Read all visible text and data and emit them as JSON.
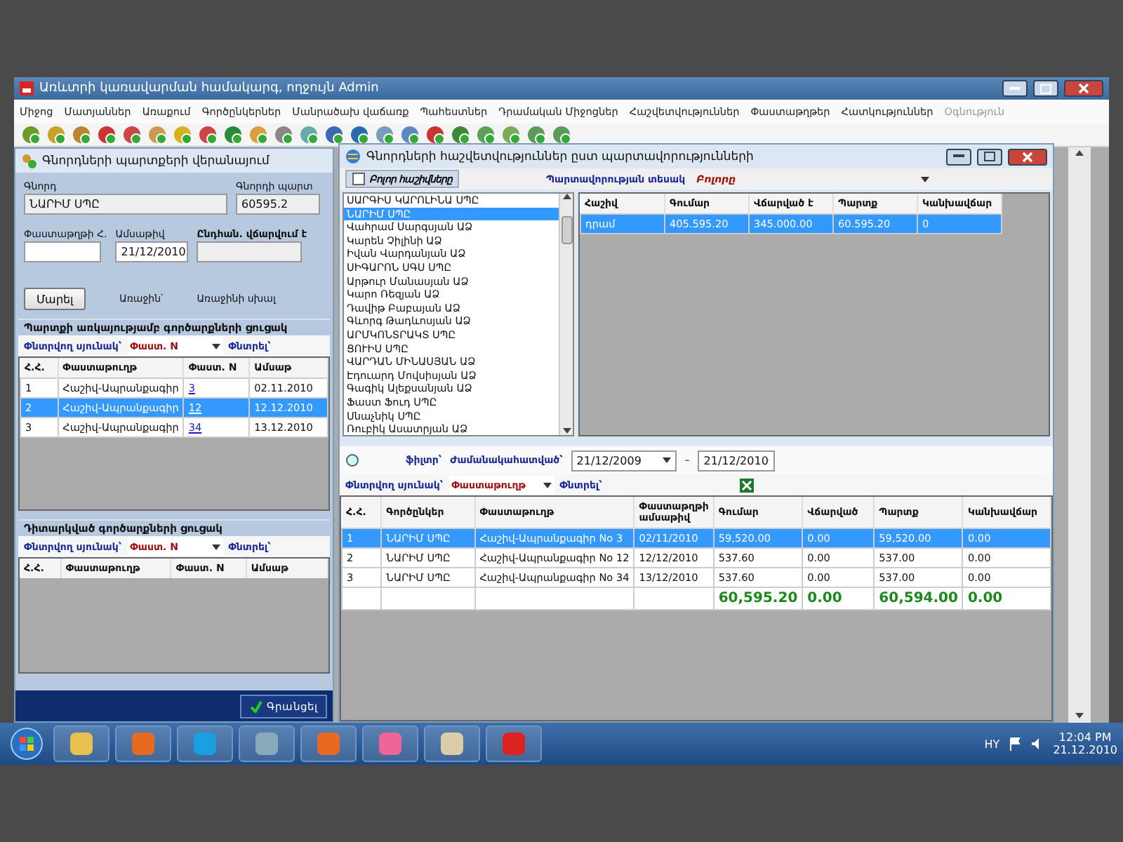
{
  "window": {
    "title": "Առևտրի կառավարման համակարգ, ողջույն Admin"
  },
  "menu": [
    {
      "label": "Միջոց",
      "disabled": false
    },
    {
      "label": "Մատյաններ",
      "disabled": false
    },
    {
      "label": "Առաքում",
      "disabled": false
    },
    {
      "label": "Գործընկերներ",
      "disabled": false
    },
    {
      "label": "Մանրածախ վաճառք",
      "disabled": false
    },
    {
      "label": "Պահեստներ",
      "disabled": false
    },
    {
      "label": "Դրամական Միջոցներ",
      "disabled": false
    },
    {
      "label": "Հաշվետվություններ",
      "disabled": false
    },
    {
      "label": "Փաստաթղթեր",
      "disabled": false
    },
    {
      "label": "Հատկություններ",
      "disabled": false
    },
    {
      "label": "Օգնություն",
      "disabled": true
    }
  ],
  "left_panel": {
    "title": "Գնորդների պարտքերի վերանայում",
    "buyer_label": "Գնորդ",
    "buyer_value": "ՆԱՐԻՄ ՍՊԸ",
    "debt_label": "Գնորդի պարտ",
    "debt_value": "60595.2",
    "doc_label": "Փաստաթղթի Հ.",
    "date_label": "Ամսաթիվ",
    "date_value": "21/12/2010",
    "total_label": "Ընդհան. վճարվում է",
    "pay_button": "Մարել",
    "first_label": "Առաջին՝",
    "first_value": "Առաջինի սխալ",
    "debts": {
      "title": "Պարտքի առկայությամբ գործարքների ցուցակ",
      "search_label": "Փնտրվող սյունակ՝",
      "search_column": "Փաստ. N",
      "find_label": "Փնտրել՝",
      "columns": [
        "Հ.Հ.",
        "Փաստաթուղթ",
        "Փաստ. N",
        "Ամսաթ"
      ],
      "rows": [
        {
          "cells": [
            "1",
            "Հաշիվ-Ապրանքագիր",
            "3",
            "02.11.2010"
          ],
          "selected": false
        },
        {
          "cells": [
            "2",
            "Հաշիվ-Ապրանքագիր",
            "12",
            "12.12.2010"
          ],
          "selected": true
        },
        {
          "cells": [
            "3",
            "Հաշիվ-Ապրանքագիր",
            "34",
            "13.12.2010"
          ],
          "selected": false
        }
      ]
    },
    "reviewed": {
      "title": "Դիտարկված գործարքների ցուցակ",
      "search_label": "Փնտրվող սյունակ՝",
      "search_column": "Փաստ. N",
      "find_label": "Փնտրել՝",
      "columns": [
        "Հ.Հ.",
        "Փաստաթուղթ",
        "Փաստ. N",
        "Ամսաթ"
      ]
    },
    "register_button": "Գրանցել"
  },
  "right_panel": {
    "title": "Գնորդների հաշվետվություններ ըստ պարտավորությունների",
    "all_accounts": {
      "label": "Բոլոր հաշիվները",
      "checked": false
    },
    "type_label": "Պարտավորության տեսակ",
    "type_value": "Բոլորը",
    "partners": [
      {
        "name": "ՍԱՐԳԻՍ ԿԱՐՈԼԻՆԱ ՍՊԸ",
        "selected": false
      },
      {
        "name": "ՆԱՐԻՄ ՍՊԸ",
        "selected": true
      },
      {
        "name": "Վահրամ Սարգսյան ԱՁ",
        "selected": false
      },
      {
        "name": "Կարեն Չիլինի ԱՁ",
        "selected": false
      },
      {
        "name": "Իվան Վարդանյան ԱՁ",
        "selected": false
      },
      {
        "name": "ՍԻԳԱՐՈՆ ՍԳՍ ՍՊԸ",
        "selected": false
      },
      {
        "name": "Արթուր Մանասյան ԱՁ",
        "selected": false
      },
      {
        "name": "Կարո Ռեզյան ԱՁ",
        "selected": false
      },
      {
        "name": "Դավիթ Բաբայան ԱՁ",
        "selected": false
      },
      {
        "name": "Գևորգ Թադևոսյան ԱՁ",
        "selected": false
      },
      {
        "name": "ԱՐՄԿՈՆՏՐԱԿՏ ՍՊԸ",
        "selected": false
      },
      {
        "name": "ՑՈՒԻՍ ՍՊԸ",
        "selected": false
      },
      {
        "name": "ՎԱՐԴԱՆ ՄԻՆԱՍՅԱՆ ԱՁ",
        "selected": false
      },
      {
        "name": "Էդուարդ Մովսիսյան ԱՁ",
        "selected": false
      },
      {
        "name": "Գագիկ Ալեքսանյան ԱՁ",
        "selected": false
      },
      {
        "name": "Ֆաստ Ֆուդ ՍՊԸ",
        "selected": false
      },
      {
        "name": "Սնաչնիկ ՍՊԸ",
        "selected": false
      },
      {
        "name": "Ռուբիկ Ասատրյան ԱՁ",
        "selected": false
      }
    ],
    "accounts": {
      "columns": [
        "Հաշիվ",
        "Գումար",
        "Վճարված է",
        "Պարտք",
        "Կանխավճար"
      ],
      "rows": [
        {
          "cells": [
            "դրամ",
            "405.595.20",
            "345.000.00",
            "60.595.20",
            "0"
          ],
          "selected": true
        }
      ]
    },
    "filter_label": "ֆիլտր՝",
    "period_label": "Ժամանակահատված՝",
    "date_from": "21/12/2009",
    "dash": "–",
    "date_to": "21/12/2010",
    "search_label": "Փնտրվող սյունակ՝",
    "search_column": "Փաստաթուղթ",
    "find_label": "Փնտրել՝",
    "documents": {
      "columns": [
        "Հ.Հ.",
        "Գործընկեր",
        "Փաստաթուղթ",
        "Փաստաթղթի ամսաթիվ",
        "Գումար",
        "Վճարված",
        "Պարտք",
        "Կանխավճար"
      ],
      "rows": [
        {
          "cells": [
            "1",
            "ՆԱՐԻՄ ՍՊԸ",
            "Հաշիվ-Ապրանքագիր No 3",
            "02/11/2010",
            "59,520.00",
            "0.00",
            "59,520.00",
            "0.00"
          ],
          "selected": true
        },
        {
          "cells": [
            "2",
            "ՆԱՐԻՄ ՍՊԸ",
            "Հաշիվ-Ապրանքագիր No 12",
            "12/12/2010",
            "537.60",
            "0.00",
            "537.00",
            "0.00"
          ],
          "selected": false
        },
        {
          "cells": [
            "3",
            "ՆԱՐԻՄ ՍՊԸ",
            "Հաշիվ-Ապրանքագիր No 34",
            "13/12/2010",
            "537.60",
            "0.00",
            "537.00",
            "0.00"
          ],
          "selected": false
        }
      ],
      "totals": [
        "60,595.20",
        "0.00",
        "60,594.00",
        "0.00"
      ]
    }
  },
  "taskbar": {
    "language": "HY",
    "time": "12:04 PM",
    "date": "21.12.2010"
  }
}
